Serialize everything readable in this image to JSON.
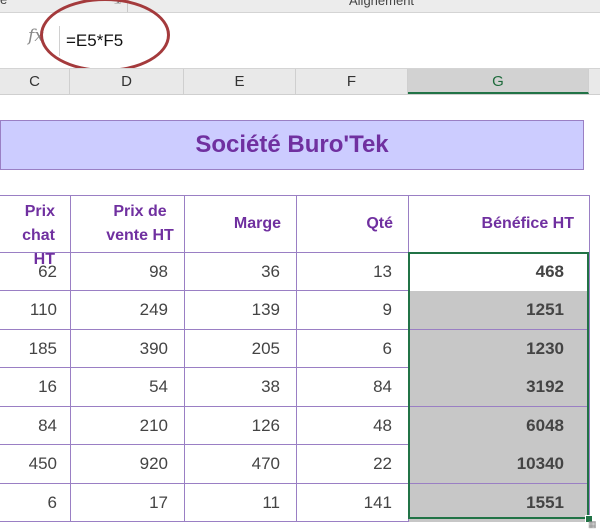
{
  "ribbon": {
    "left_label": "e",
    "group_label": "Alignement",
    "corner_icon": "dialog-launcher-icon"
  },
  "formula_bar": {
    "fx_label": "fx",
    "formula": "=E5*F5"
  },
  "column_headers": [
    "C",
    "D",
    "E",
    "F",
    "G"
  ],
  "selected_column": "G",
  "sheet_title": "Société Buro'Tek",
  "table": {
    "headers": {
      "achat": [
        "Prix",
        "chat HT"
      ],
      "vente": [
        "Prix de",
        "vente HT"
      ],
      "marge": "Marge",
      "qte": "Qté",
      "benefice": "Bénéfice HT"
    },
    "rows": [
      {
        "achat": "62",
        "vente": "98",
        "marge": "36",
        "qte": "13",
        "benefice": "468"
      },
      {
        "achat": "110",
        "vente": "249",
        "marge": "139",
        "qte": "9",
        "benefice": "1251"
      },
      {
        "achat": "185",
        "vente": "390",
        "marge": "205",
        "qte": "6",
        "benefice": "1230"
      },
      {
        "achat": "16",
        "vente": "54",
        "marge": "38",
        "qte": "84",
        "benefice": "3192"
      },
      {
        "achat": "84",
        "vente": "210",
        "marge": "126",
        "qte": "48",
        "benefice": "6048"
      },
      {
        "achat": "450",
        "vente": "920",
        "marge": "470",
        "qte": "22",
        "benefice": "10340"
      },
      {
        "achat": "6",
        "vente": "17",
        "marge": "11",
        "qte": "141",
        "benefice": "1551"
      }
    ]
  },
  "colors": {
    "accent": "#7030a0",
    "title_fill": "#ccccff",
    "selection": "#217346",
    "highlight": "#c7c7c7",
    "annotation_circle": "#a43a3c"
  }
}
